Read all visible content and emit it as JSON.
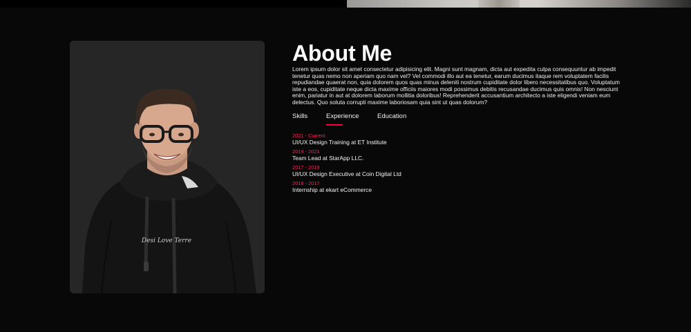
{
  "about": {
    "title": "About Me",
    "bio": "Lorem ipsum dolor sit amet consectetur adipisicing elit. Magni sunt magnam, dicta aut expedita culpa consequuntur ab impedit tenetur quas nemo non aperiam quo nam vel? Vel commodi illo aut ea tenetur, earum ducimus itaque rem voluptatem facilis repudiandae quaerat non, quia dolorem quos quas minus deleniti nostrum cupiditate dolor libero necessitatibus quo. Voluptatum iste a eos, cupiditate neque dicta maxime officiis maiores modi possimus debitis recusandae ducimus quis omnis! Non nesciunt enim, pariatur in aut at dolorem laborum mollitia doloribus! Reprehenderit accusantium architecto a iste eligendi veniam eum delectus. Quo soluta corrupti maxime laboriosam quia sint ut quas dolorum?"
  },
  "tabs": [
    {
      "label": "Skills",
      "active": false
    },
    {
      "label": "Experience",
      "active": true
    },
    {
      "label": "Education",
      "active": false
    }
  ],
  "experience": [
    {
      "years": "2021 - Current",
      "role": "UI/UX Design Training at ET Institute"
    },
    {
      "years": "2019 - 2021",
      "role": "Team Lead at StarApp LLC."
    },
    {
      "years": "2017 - 2019",
      "role": "UI/UX Design Executive at Coin Digital Ltd"
    },
    {
      "years": "2016 - 2017",
      "role": "Internship at ekart eCommerce"
    }
  ],
  "hoodie_print": "Desi Love Terre",
  "colors": {
    "background": "#080808",
    "accent": "#ff1f5a",
    "card": "#262626",
    "text": "#ffffff"
  }
}
